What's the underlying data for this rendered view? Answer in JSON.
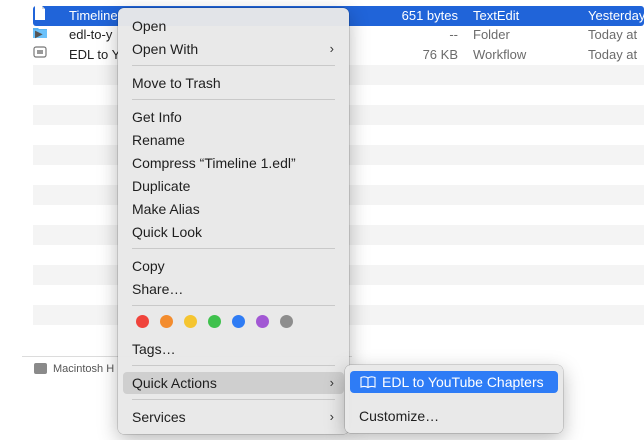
{
  "finder": {
    "rows": [
      {
        "name": "Timeline",
        "size": "651 bytes",
        "kind": "TextEdit",
        "date": "Yesterday",
        "selected": true
      },
      {
        "name": "edl-to-y",
        "size": "--",
        "kind": "Folder",
        "date": "Today at",
        "selected": false
      },
      {
        "name": "EDL to Y",
        "size": "76 KB",
        "kind": "Workflow",
        "date": "Today at",
        "selected": false
      }
    ],
    "pathbar_label": "Macintosh H"
  },
  "context_menu": {
    "open": "Open",
    "open_with": "Open With",
    "move_to_trash": "Move to Trash",
    "get_info": "Get Info",
    "rename": "Rename",
    "compress": "Compress “Timeline 1.edl”",
    "duplicate": "Duplicate",
    "make_alias": "Make Alias",
    "quick_look": "Quick Look",
    "copy": "Copy",
    "share": "Share…",
    "tags": "Tags…",
    "quick_actions": "Quick Actions",
    "services": "Services",
    "submenu_arrow": "›",
    "tag_colors": [
      "#f0443c",
      "#f38c2e",
      "#f5c530",
      "#3fc14d",
      "#2f7cf4",
      "#a258d4",
      "#8d8d8d"
    ]
  },
  "quick_actions_submenu": {
    "edl_to_youtube": "EDL to YouTube Chapters",
    "customize": "Customize…"
  },
  "colors": {
    "selection_blue": "#2064d9",
    "menu_highlight": "#2e7cf6"
  }
}
